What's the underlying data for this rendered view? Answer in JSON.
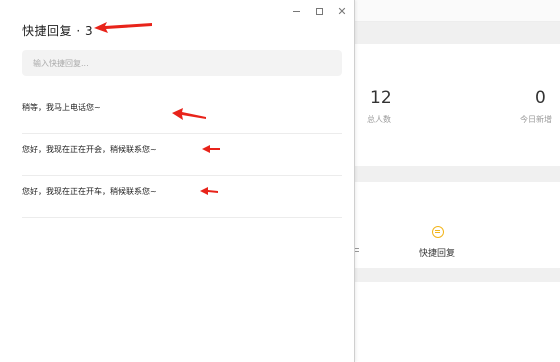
{
  "background": {
    "stats": [
      {
        "value": "12",
        "label": "总人数"
      },
      {
        "value": "0",
        "label": "今日新增"
      }
    ],
    "quick_reply_label": "快捷回复",
    "quick_reply_icon": "chat-bubble-icon"
  },
  "popup": {
    "title": "快捷回复 · 3",
    "search_placeholder": "输入快捷回复...",
    "replies": [
      "稍等，我马上电话您~",
      "您好，我现在正在开会，稍候联系您~",
      "您好，我现在正在开车，稍候联系您~"
    ],
    "window_controls": [
      "minimize-icon",
      "maximize-icon",
      "close-icon"
    ],
    "annotation_color": "#e8231a"
  }
}
